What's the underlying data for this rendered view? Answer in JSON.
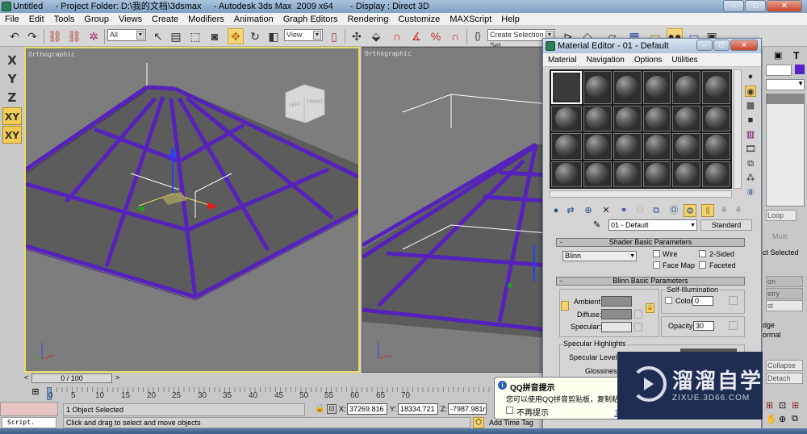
{
  "window": {
    "title": "Untitled     - Project Folder: D:\\我的文档\\3dsmax     - Autodesk 3ds Max  2009 x64       - Display : Direct 3D",
    "controls": {
      "minimize": "–",
      "maximize": "□",
      "close": "✕"
    }
  },
  "menubar": [
    "File",
    "Edit",
    "Tools",
    "Group",
    "Views",
    "Create",
    "Modifiers",
    "Animation",
    "Graph Editors",
    "Rendering",
    "Customize",
    "MAXScript",
    "Help"
  ],
  "toolbar": {
    "undo_icon": "↶",
    "redo_icon": "↷",
    "selection_filter": "All",
    "reference_coord": "View",
    "named_selection_placeholder": "Create Selection Set",
    "active_tool": "select-and-move"
  },
  "axis_constraints": [
    "X",
    "Y",
    "Z",
    "XY",
    "XY"
  ],
  "viewports": [
    {
      "label": "Orthographic",
      "active": true,
      "viewcube": {
        "left": "LEFT",
        "front": "FRONT"
      }
    },
    {
      "label": "Orthographic",
      "active": false
    }
  ],
  "time_slider": {
    "value": "0 / 100",
    "prev": "<",
    "next": ">"
  },
  "trackbar": {
    "ticks": [
      "0",
      "5",
      "10",
      "15",
      "20",
      "25",
      "30",
      "35",
      "40",
      "45",
      "50",
      "55",
      "60",
      "65",
      "70"
    ]
  },
  "status": {
    "selection": "1 Object Selected",
    "prompt": "Click and drag to select and move objects",
    "script_label": "Script.",
    "x_label": "X:",
    "x_value": "37269.816",
    "y_label": "Y:",
    "y_value": "18334.721",
    "z_label": "Z:",
    "z_value": "-7987.981r",
    "add_time_tag": "Add Time Tag"
  },
  "material_editor": {
    "title": "Material Editor - 01 - Default",
    "menu": [
      "Material",
      "Navigation",
      "Options",
      "Utilities"
    ],
    "slot_count": 24,
    "active_slot": 0,
    "material_name": "01 - Default",
    "material_type": "Standard",
    "shader_rollout": {
      "title": "Shader Basic Parameters",
      "shader": "Blinn",
      "wire": "Wire",
      "wire_checked": false,
      "two_sided": "2-Sided",
      "two_sided_checked": false,
      "face_map": "Face Map",
      "face_map_checked": false,
      "faceted": "Faceted",
      "faceted_checked": false
    },
    "blinn_rollout": {
      "title": "Blinn Basic Parameters",
      "ambient": "Ambient:",
      "ambient_color": "#8c8c8c",
      "diffuse": "Diffuse:",
      "diffuse_color": "#8c8c8c",
      "specular": "Specular:",
      "specular_color": "#e6e6e6",
      "self_illum_title": "Self-Illumination",
      "color_label": "Color",
      "self_illum_value": "0",
      "opacity_label": "Opacity:",
      "opacity_value": "30",
      "spec_highlights_title": "Specular Highlights",
      "spec_level": "Specular Level:",
      "glossiness": "Glossiness:"
    }
  },
  "command_panel": {
    "fields": [
      "Loop",
      "Multi",
      "ct Selected",
      "on",
      "etry",
      "st",
      "dge",
      "ormal",
      "Collapse",
      "Detach"
    ],
    "object_color": "#5522cc"
  },
  "qq_popup": {
    "title": "QQ拼音提示",
    "message": "您可以使用QQ拼音剪贴板，复制粘贴",
    "checkbox_label": "不再提示",
    "link": "立"
  },
  "watermark": {
    "cn": "溜溜自学",
    "en": "ZIXUE.3D66.COM"
  }
}
